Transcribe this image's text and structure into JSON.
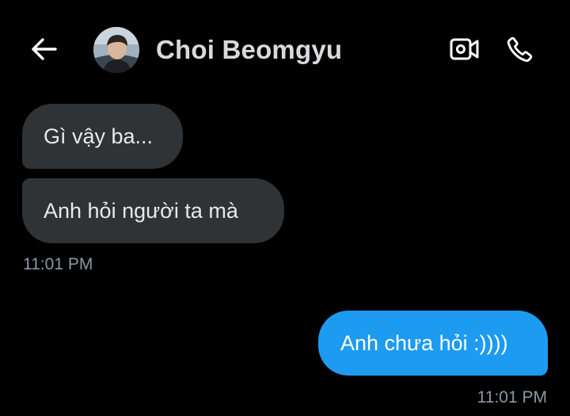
{
  "header": {
    "contact_name": "Choi Beomgyu",
    "back_icon": "arrow-left-icon",
    "video_icon": "video-camera-icon",
    "call_icon": "phone-icon"
  },
  "messages": [
    {
      "direction": "incoming",
      "text": "Gì vậy ba..."
    },
    {
      "direction": "incoming",
      "text": "Anh hỏi người ta mà"
    },
    {
      "direction": "outgoing",
      "text": "Anh chưa hỏi :))))"
    }
  ],
  "timestamps": {
    "incoming_group": "11:01 PM",
    "outgoing_group": "11:01 PM"
  },
  "colors": {
    "background": "#000000",
    "incoming_bubble": "#2f3336",
    "outgoing_bubble": "#1d9bf0",
    "timestamp": "#8b98a5"
  }
}
